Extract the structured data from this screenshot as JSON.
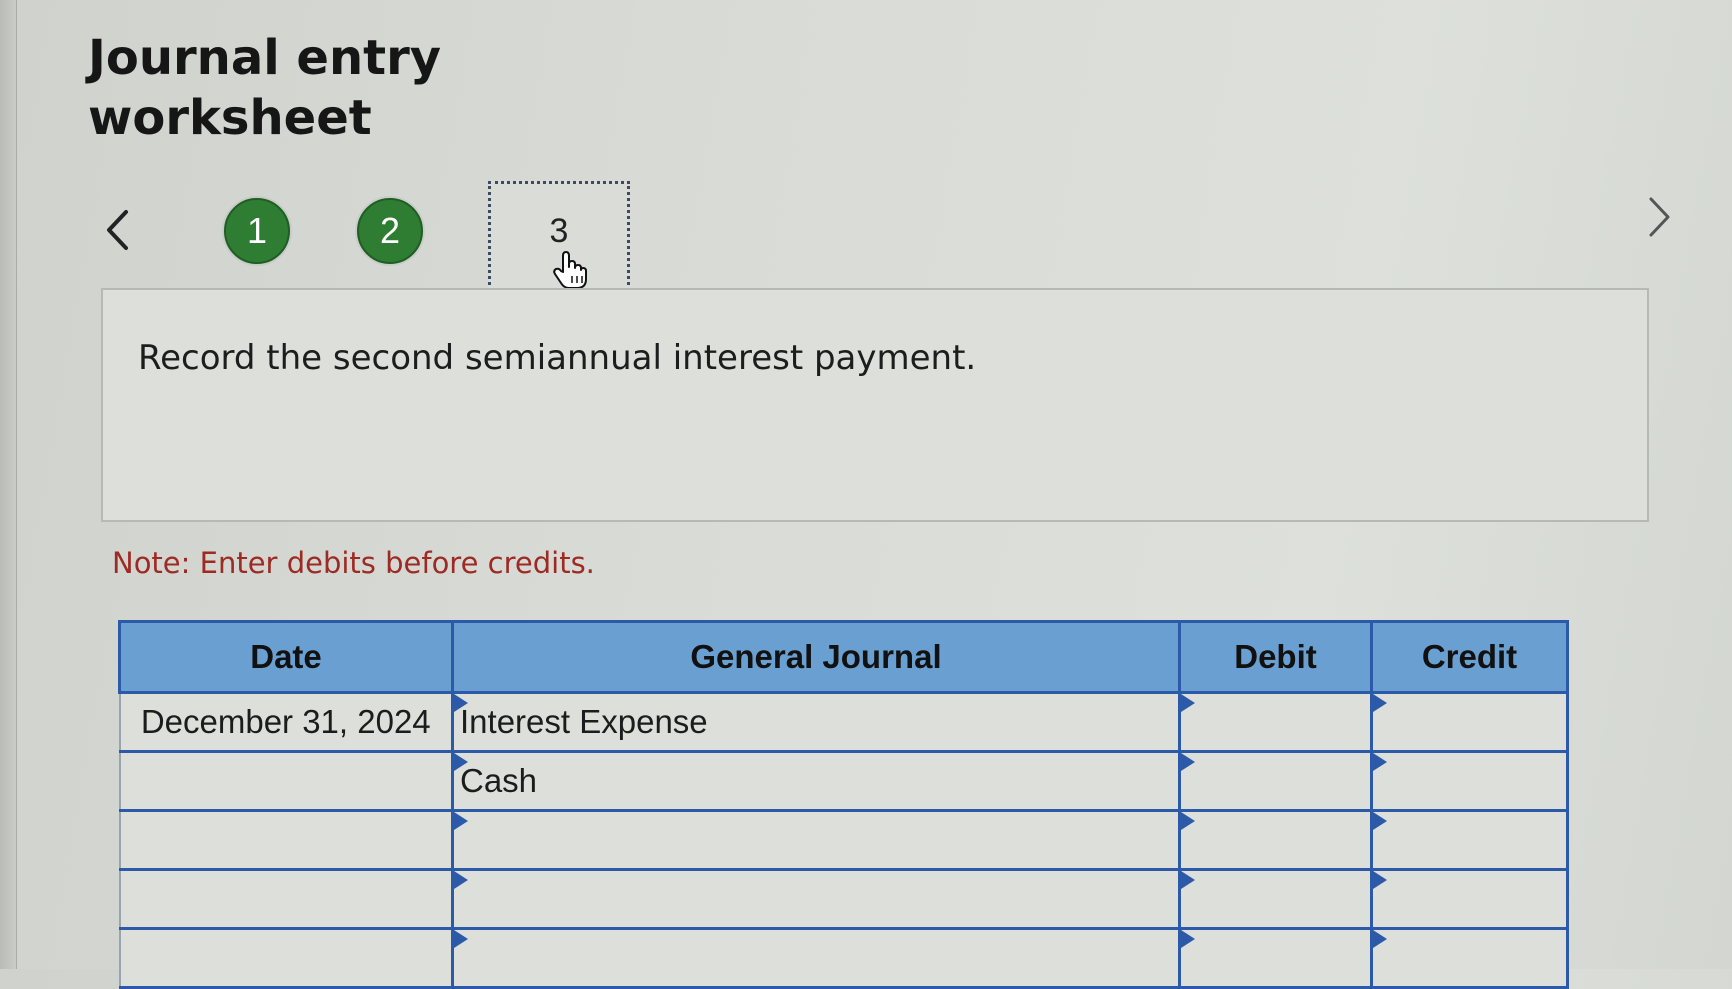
{
  "header": {
    "title": "Journal entry worksheet"
  },
  "steps": {
    "items": [
      {
        "label": "1",
        "status": "complete"
      },
      {
        "label": "2",
        "status": "complete"
      },
      {
        "label": "3",
        "status": "current"
      }
    ]
  },
  "instruction": "Record the second semiannual interest payment.",
  "note": "Note: Enter debits before credits.",
  "table": {
    "headers": {
      "date": "Date",
      "general_journal": "General Journal",
      "debit": "Debit",
      "credit": "Credit"
    },
    "rows": [
      {
        "date": "December 31, 2024",
        "account": "Interest Expense",
        "debit": "",
        "credit": ""
      },
      {
        "date": "",
        "account": "Cash",
        "debit": "",
        "credit": ""
      },
      {
        "date": "",
        "account": "",
        "debit": "",
        "credit": ""
      },
      {
        "date": "",
        "account": "",
        "debit": "",
        "credit": ""
      },
      {
        "date": "",
        "account": "",
        "debit": "",
        "credit": ""
      }
    ]
  },
  "icons": {
    "prev": "chevron-left-icon",
    "next": "chevron-right-icon",
    "cursor": "hand-pointer-icon",
    "row_marker": "row-flag-icon"
  },
  "colors": {
    "step_complete": "#2e7d32",
    "header_bg": "#6a9fd1",
    "grid_border": "#2d5aa8",
    "note_text": "#9e2a24"
  }
}
